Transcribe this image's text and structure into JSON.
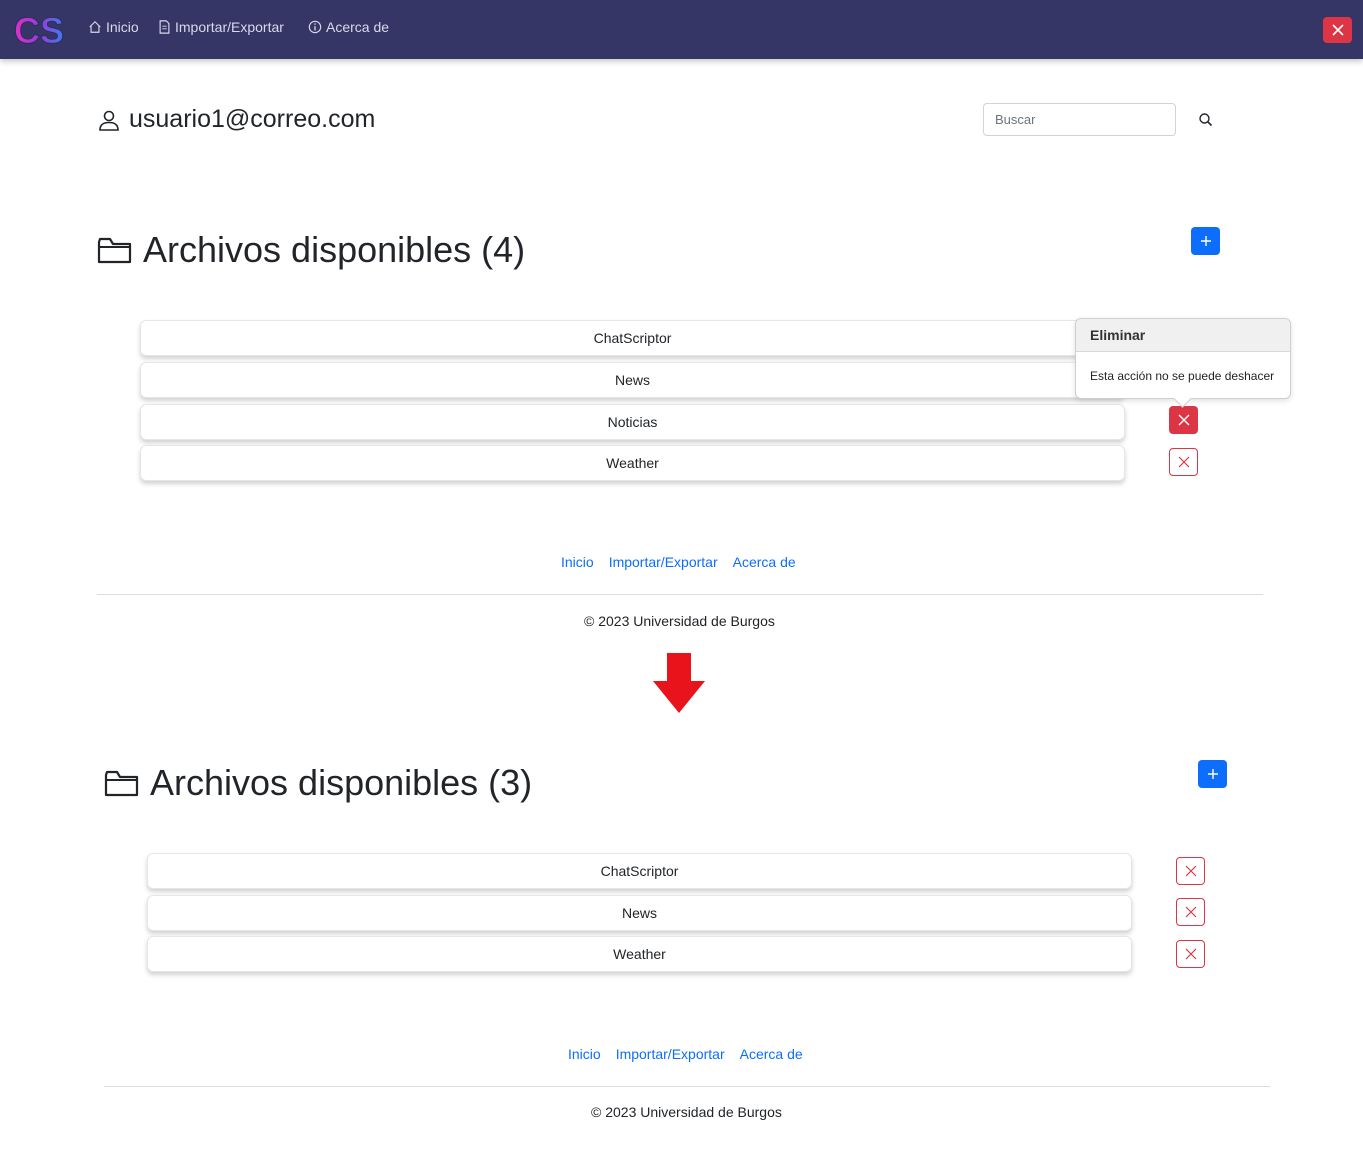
{
  "navbar": {
    "logo_text": "CS",
    "links": [
      {
        "label": "Inicio",
        "icon": "house-icon"
      },
      {
        "label": "Importar/Exportar",
        "icon": "file-icon"
      },
      {
        "label": "Acerca de",
        "icon": "info-circle-icon"
      }
    ],
    "close_icon": "close-icon"
  },
  "user": {
    "email": "usuario1@correo.com",
    "icon": "person-icon"
  },
  "search": {
    "placeholder": "Buscar",
    "icon": "search-icon"
  },
  "before": {
    "title": "Archivos disponibles (4)",
    "files": [
      "ChatScriptor",
      "News",
      "Noticias",
      "Weather"
    ]
  },
  "popover": {
    "header": "Eliminar",
    "body": "Esta acción no se puede deshacer"
  },
  "after": {
    "title": "Archivos disponibles (3)",
    "files": [
      "ChatScriptor",
      "News",
      "Weather"
    ]
  },
  "footer": {
    "links": [
      "Inicio",
      "Importar/Exportar",
      "Acerca de"
    ],
    "copyright": "© 2023 Universidad de Burgos"
  },
  "colors": {
    "navbar": "#353566",
    "primary": "#0d6efd",
    "danger": "#dc3545",
    "arrow": "#e8131b"
  }
}
